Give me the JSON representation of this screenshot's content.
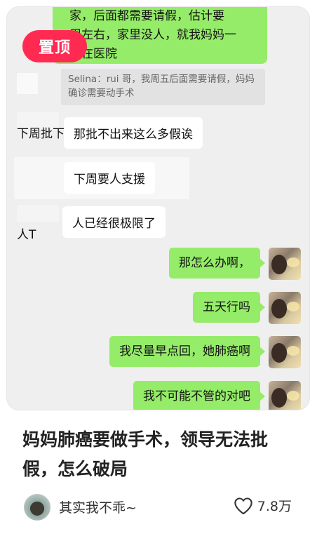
{
  "pin_badge": "置顶",
  "chat": {
    "top_green_text": "家，后面都需要请假，估计要一周左右，家里没人，就我妈妈一个人在医院",
    "top_green_visible": "家，后面都需要请假，估计要\n周左右，家里没人，就我妈妈一\n人在医院",
    "quote_text": "Selina：rui 哥，我周五后面需要请假，妈妈确诊需要动手术",
    "stray_1": "下周批下",
    "white_1": "那批不出来这么多假诶",
    "white_2": "下周要人支援",
    "stray_2": "人T",
    "white_3": "人已经很极限了",
    "right_messages": [
      "那怎么办啊，",
      "五天行吗",
      "我尽量早点回，她肺癌啊",
      "我不可能不管的对吧"
    ]
  },
  "post": {
    "title": "妈妈肺癌要做手术，领导无法批假，怎么破局",
    "author": "其实我不乖~",
    "likes": "7.8万"
  },
  "colors": {
    "green_bubble": "#95ec69",
    "pin_red": "#ff2a52",
    "chat_bg": "#efefef"
  },
  "icons": {
    "like": "heart-outline-icon"
  }
}
